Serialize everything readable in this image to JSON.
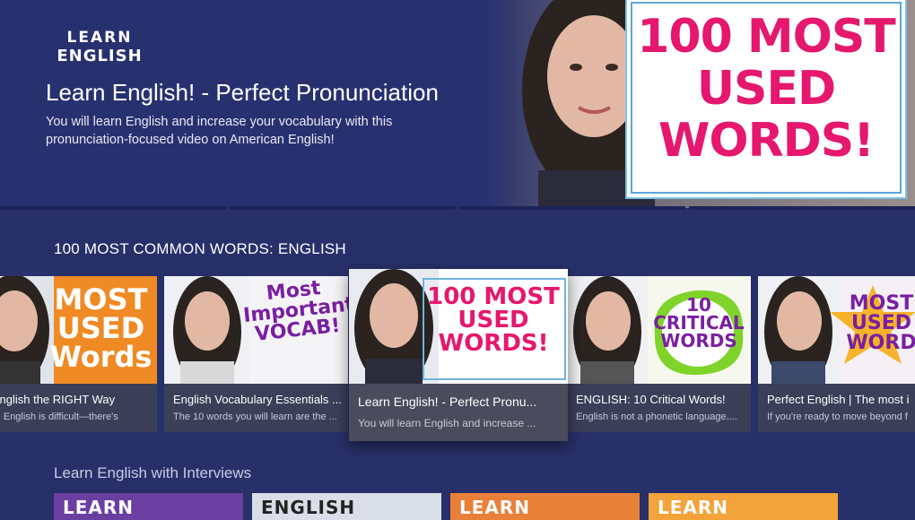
{
  "hero": {
    "logo_line1": "LEARN",
    "logo_line2": "ENGLISH",
    "title": "Learn English! - Perfect Pronunciation",
    "description": "You will learn English and increase your vocabulary with this pronunciation-focused video on American English!",
    "thumbnail_text": "100 MOST USED WORDS!"
  },
  "row1": {
    "title": "100 MOST COMMON WORDS: ENGLISH",
    "cards": [
      {
        "title": "n English the RIGHT Way",
        "desc": "ning English is difficult—there's",
        "thumb_text": "MOST USED Words",
        "focused": false
      },
      {
        "title": "English Vocabulary Essentials ...",
        "desc": "The 10 words you will learn are the ...",
        "thumb_text": "Most Important VOCAB!",
        "focused": false
      },
      {
        "title": "Learn English! - Perfect Pronu...",
        "desc": "You will learn English and increase ...",
        "thumb_text": "100 MOST USED WORDS!",
        "focused": true
      },
      {
        "title": "ENGLISH: 10 Critical Words!",
        "desc": "English is not a phonetic language....",
        "thumb_text": "10 CRITICAL WORDS",
        "focused": false
      },
      {
        "title": "Perfect English | The most i",
        "desc": "If you're ready to move beyond f",
        "thumb_text": "MOST USED WORD",
        "focused": false
      }
    ]
  },
  "row2": {
    "title": "Learn English with Interviews",
    "tiles": [
      "LEARN",
      "ENGLISH",
      "LEARN",
      "LEARN"
    ]
  },
  "colors": {
    "background": "#273069",
    "pink": "#e5176e",
    "purple": "#7a1fa2",
    "orange": "#f08a24",
    "green": "#7fd32b"
  }
}
